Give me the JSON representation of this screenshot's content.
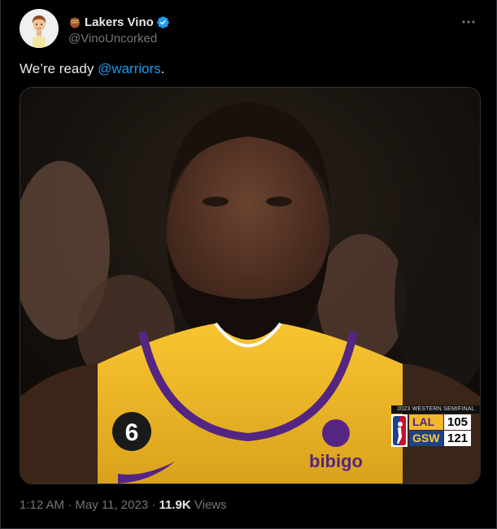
{
  "author": {
    "display_name": "Lakers Vino",
    "handle": "@VinoUncorked",
    "verified": true,
    "avatar_icon": "cartoon-avatar",
    "name_emoji_icon": "owl-icon"
  },
  "tweet": {
    "text_before": "We’re ready ",
    "mention": "@warriors",
    "text_after": "."
  },
  "media": {
    "scorebug": {
      "title": "2023 WESTERN SEMIFINAL",
      "teams": [
        {
          "abbr": "LAL",
          "score": "105"
        },
        {
          "abbr": "GSW",
          "score": "121"
        }
      ]
    },
    "jersey": {
      "number": "6",
      "sponsor": "bibigo"
    }
  },
  "meta": {
    "time": "1:12 AM",
    "separator1": " · ",
    "date": "May 11, 2023",
    "separator2": " · ",
    "views_count": "11.9K",
    "views_label": " Views"
  },
  "colors": {
    "accent": "#1d9bf0",
    "background": "#000000",
    "secondary_text": "#71767b",
    "lakers_gold": "#fdb927",
    "lakers_purple": "#552583"
  }
}
